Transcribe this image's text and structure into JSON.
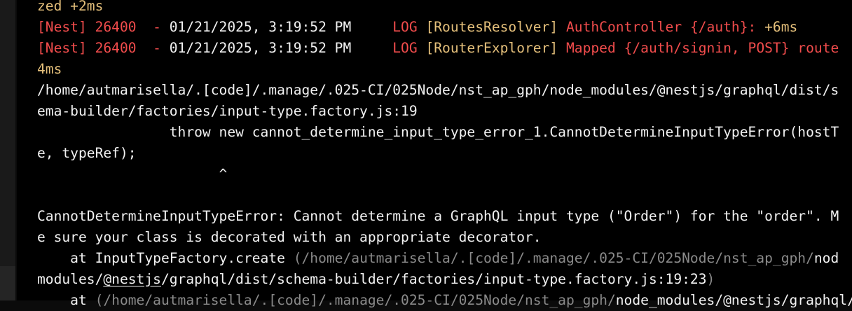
{
  "colors": {
    "background": "#000000",
    "gutter": "#1a1a1a",
    "default_text": "#f2f2f2",
    "yellow": "#e5c07b",
    "red": "#f14c4c",
    "dim": "#8a8a8a"
  },
  "terminal": {
    "line1_yellow": "zed +2ms",
    "log1": {
      "prefix": "[Nest] 26400  - ",
      "timestamp": "01/21/2025, 3:19:52 PM",
      "spacer": "     ",
      "level": "LOG",
      "context": " [RoutesResolver]",
      "message": " AuthController {/auth}:",
      "elapsed": " +6ms"
    },
    "log2": {
      "prefix": "[Nest] 26400  - ",
      "timestamp": "01/21/2025, 3:19:52 PM",
      "spacer": "     ",
      "level": "LOG",
      "context": " [RouterExplorer]",
      "message": " Mapped {/auth/signin, POST} route"
    },
    "line4_yellow": "4ms",
    "path_line1": "/home/autmarisella/.[code]/.manage/.025-CI/025Node/nst_ap_gph/node_modules/@nestjs/graphql/dist/s",
    "path_line2": "ema-builder/factories/input-type.factory.js:19",
    "throw_line1": "                throw new cannot_determine_input_type_error_1.CannotDetermineInputTypeError(hostT",
    "throw_line2": "e, typeRef);",
    "caret_line": "                      ^",
    "error_line1": "CannotDetermineInputTypeError: Cannot determine a GraphQL input type (\"Order\") for the \"order\". M",
    "error_line2": "e sure your class is decorated with an appropriate decorator.",
    "stack1": {
      "indent": "    at ",
      "fn": "InputTypeFactory.create",
      "path_dim": " (/home/autmarisella/.[code]/.manage/.025-CI/025Node/nst_ap_gph/",
      "path_bright": "nod"
    },
    "stack1_cont": {
      "part1": "modules/",
      "part2": "@nestjs",
      "part3": "/graphql/dist/schema-builder/factories/input-type.factory.js:19:23",
      "close": ")"
    },
    "stack2": {
      "indent": "    at ",
      "path_dim": "(/home/autmarisella/.[code]/.manage/.025-CI/025Node/nst_ap_gph/",
      "path_bright": "node_modules/@nestjs/graphql/"
    }
  }
}
